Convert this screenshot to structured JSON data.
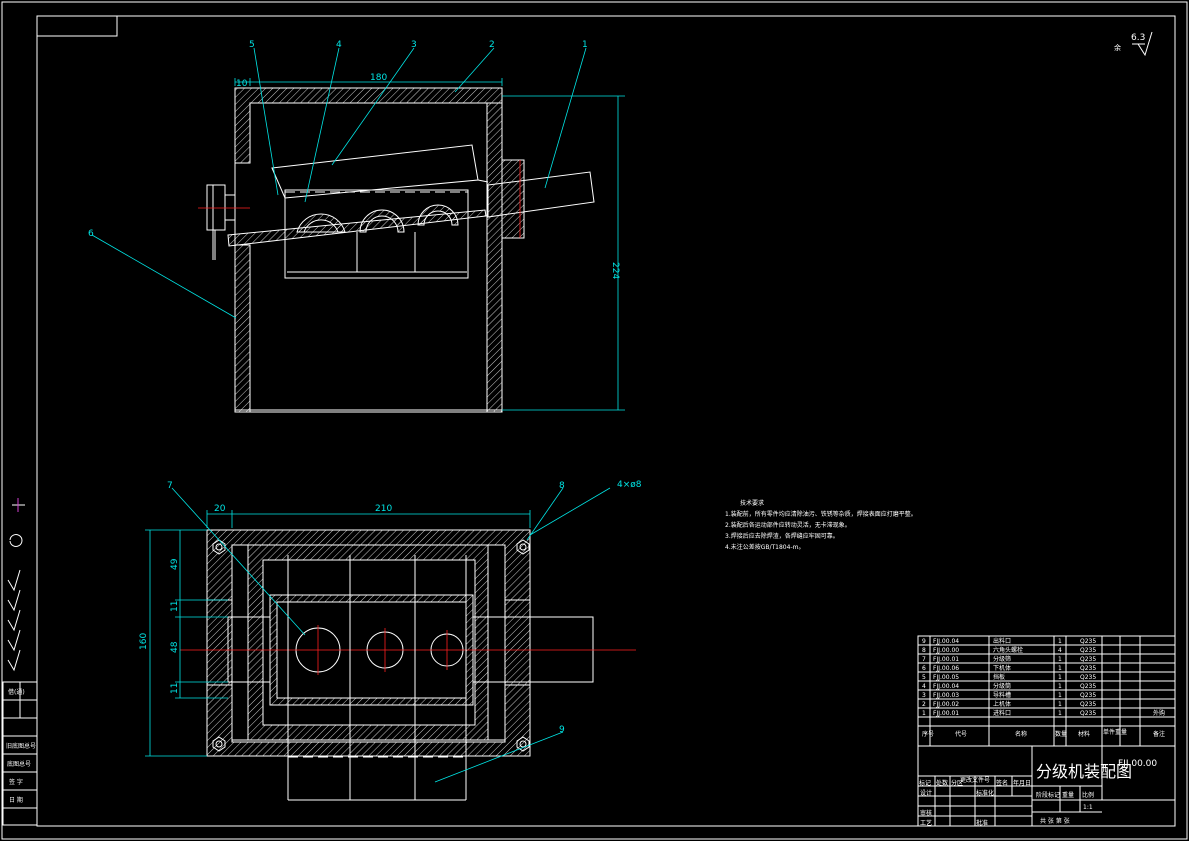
{
  "balloons": [
    "5",
    "4",
    "3",
    "2",
    "1",
    "6",
    "7",
    "8",
    "9"
  ],
  "dims": {
    "top_left": "10",
    "top_width": "180",
    "top_height": "224",
    "bot_left": "20",
    "bot_width": "210",
    "hole_spec": "4×ø8",
    "bot_height": "160",
    "d49": "49",
    "d11a": "11",
    "d48": "48",
    "d11b": "11"
  },
  "surface_finish": {
    "value": "6.3",
    "rest": "余"
  },
  "tech_requirements": {
    "title": "技术要求",
    "lines": [
      "1.装配前，所有零件均应清除油污、铁锈等杂质，焊接表面应打磨平整。",
      "2.装配后各运动部件应转动灵活，无卡滞现象。",
      "3.焊接后应去除焊渣，各焊缝应牢固可靠。",
      "4.未注公差按GB/T1804-m。"
    ]
  },
  "bom": {
    "rows": [
      {
        "no": "9",
        "code": "FJJ.00.04",
        "name": "出料口",
        "qty": "1",
        "material": "Q235",
        "note": ""
      },
      {
        "no": "8",
        "code": "FJJ.00.00",
        "name": "六角头螺栓",
        "qty": "4",
        "material": "Q235",
        "note": ""
      },
      {
        "no": "7",
        "code": "FJJ.00.01",
        "name": "分级筛",
        "qty": "1",
        "material": "Q235",
        "note": ""
      },
      {
        "no": "6",
        "code": "FJJ.00.06",
        "name": "下机体",
        "qty": "1",
        "material": "Q235",
        "note": ""
      },
      {
        "no": "5",
        "code": "FJJ.00.05",
        "name": "挡板",
        "qty": "1",
        "material": "Q235",
        "note": ""
      },
      {
        "no": "4",
        "code": "FJJ.00.04",
        "name": "分级筒",
        "qty": "1",
        "material": "Q235",
        "note": ""
      },
      {
        "no": "3",
        "code": "FJJ.00.03",
        "name": "导料槽",
        "qty": "1",
        "material": "Q235",
        "note": ""
      },
      {
        "no": "2",
        "code": "FJJ.00.02",
        "name": "上机体",
        "qty": "1",
        "material": "Q235",
        "note": ""
      },
      {
        "no": "1",
        "code": "FJJ.00.01",
        "name": "进料口",
        "qty": "1",
        "material": "Q235",
        "note": "外购"
      }
    ],
    "headers": [
      "序号",
      "代号",
      "名称",
      "数量",
      "材料",
      "单件重量",
      "备注"
    ]
  },
  "title_block": {
    "title": "分级机装配图",
    "drawing_no": "FJJ.00.00",
    "scale": "1:1",
    "labels": [
      "标记",
      "处数",
      "分区",
      "更改文件号",
      "签名",
      "年月日",
      "设计",
      "标准化",
      "审核",
      "工艺",
      "批准",
      "阶段标记",
      "重量",
      "比例",
      "共 张 第 张"
    ]
  },
  "side_labels": [
    "借 (通) 用件登记",
    "旧底图总号",
    "底图总号",
    "签 字",
    "日 期"
  ]
}
